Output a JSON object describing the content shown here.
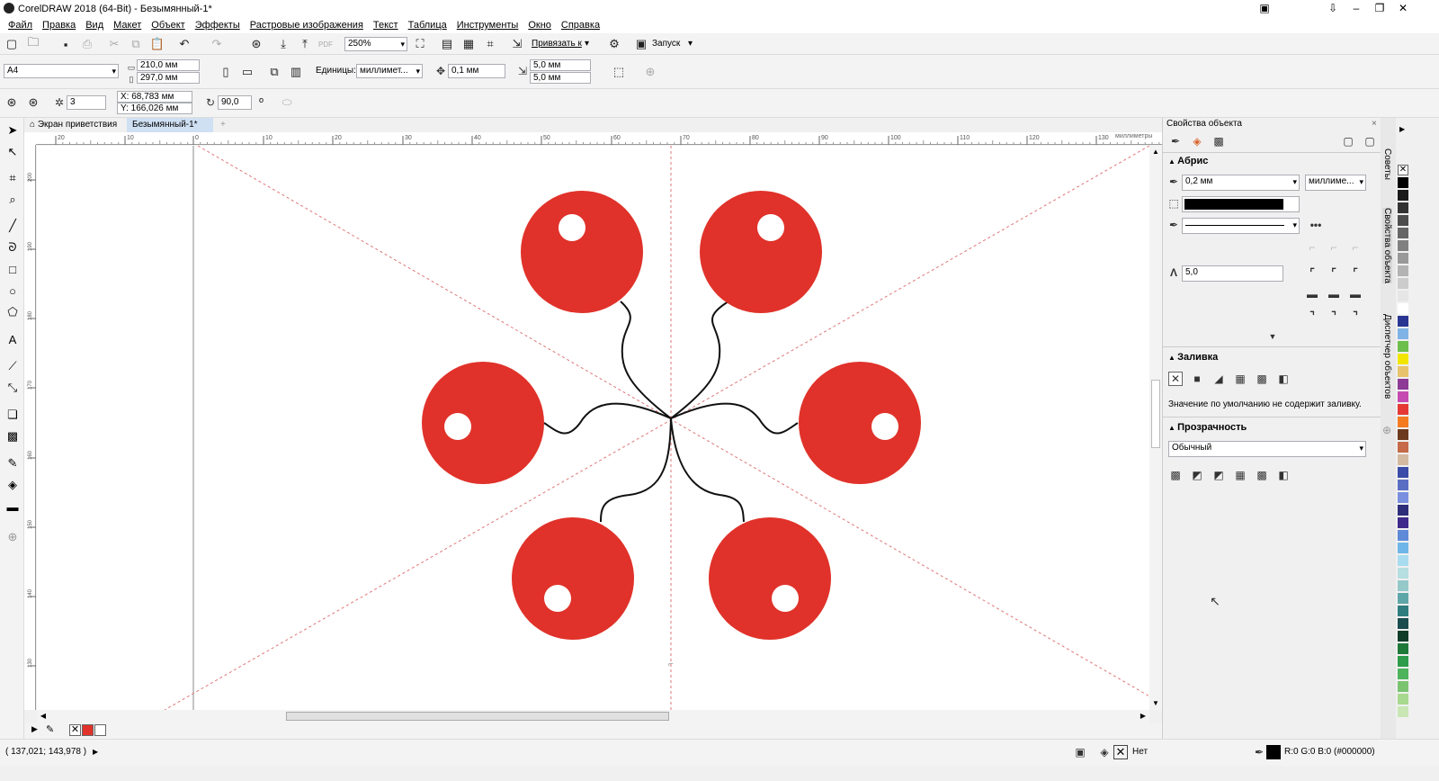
{
  "window": {
    "title": "CorelDRAW 2018 (64-Bit) - Безымянный-1*"
  },
  "menu": [
    "Файл",
    "Правка",
    "Вид",
    "Макет",
    "Объект",
    "Эффекты",
    "Растровые изображения",
    "Текст",
    "Таблица",
    "Инструменты",
    "Окно",
    "Справка"
  ],
  "standard_toolbar": {
    "zoom": "250%",
    "snap_label": "Привязать к",
    "launch_label": "Запуск"
  },
  "property_bar": {
    "page_size": "A4",
    "page_width": "210,0 мм",
    "page_height": "297,0 мм",
    "units_label": "Единицы:",
    "units_value": "миллимет...",
    "nudge": "0,1 мм",
    "dup_x": "5,0 мм",
    "dup_y": "5,0 мм"
  },
  "transform_bar": {
    "count": "3",
    "x": "X: 68,783 мм",
    "y": "Y: 166,026 мм",
    "angle": "90,0",
    "degree_sign": "o"
  },
  "doc_tabs": {
    "welcome": "Экран приветствия",
    "document": "Безымянный-1*"
  },
  "rulers": {
    "h_ticks": [
      "20",
      "10",
      "0",
      "10",
      "20",
      "30",
      "40",
      "50",
      "60",
      "70",
      "80",
      "90",
      "100",
      "110",
      "120",
      "130"
    ],
    "h_unit": "миллиметры",
    "v_ticks": [
      "200",
      "190",
      "180",
      "170",
      "160",
      "150",
      "140",
      "130"
    ]
  },
  "canvas": {
    "fill_color": "#e0322a",
    "line_color": "#000000",
    "guide_color": "#e05a5a"
  },
  "object_properties": {
    "title": "Свойства объекта",
    "outline_section": "Абрис",
    "outline_width": "0,2 мм",
    "outline_units": "миллиме...",
    "miter_limit": "5,0",
    "fill_section": "Заливка",
    "fill_note": "Значение по умолчанию не содержит заливку.",
    "transparency_section": "Прозрачность",
    "transparency_mode": "Обычный"
  },
  "docker_tabs": [
    "Советы",
    "Свойства объекта",
    "Диспетчер объектов"
  ],
  "status": {
    "coords": "( 137,021; 143,978 )",
    "fill_label": "Нет",
    "outline_color": "R:0 G:0 B:0 (#000000)"
  },
  "palette_colors": [
    "#000000",
    "#1a1a1a",
    "#333333",
    "#4d4d4d",
    "#666666",
    "#808080",
    "#999999",
    "#b3b3b3",
    "#cccccc",
    "#e6e6e6",
    "#ffffff",
    "#283593",
    "#7fb3e6",
    "#6cbf4a",
    "#f2e600",
    "#e8c36b",
    "#8e3a97",
    "#c64bb0",
    "#e53935",
    "#f47b20",
    "#6d3a1f",
    "#c66a4a",
    "#d4b9a1",
    "#3a4ca8",
    "#5a6fc4",
    "#7a8fe0",
    "#2d2d7a",
    "#3e2a8a",
    "#5e8ad8",
    "#6fb7e8",
    "#a9dcef",
    "#b6dfe0",
    "#94c8c9",
    "#5fa6a8",
    "#2f7d7f",
    "#1b4d4f",
    "#0f3d2a",
    "#1f7a3a",
    "#2e9c4a",
    "#4db35c",
    "#7ac470",
    "#a8d98f",
    "#c9e6b5"
  ]
}
